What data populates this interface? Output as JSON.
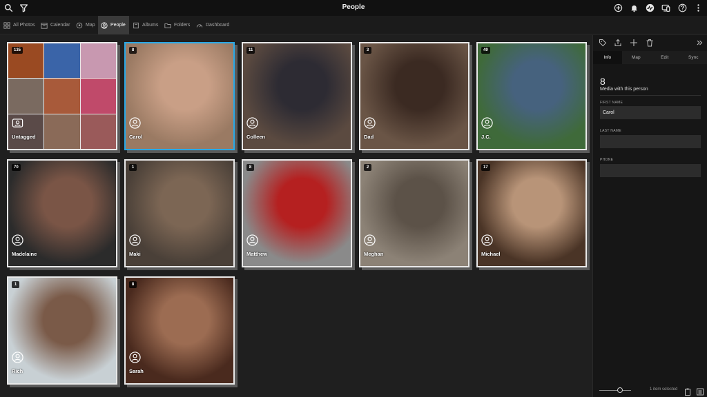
{
  "app": {
    "title": "People"
  },
  "topbar": {
    "left_icons": [
      "search-icon",
      "filter-icon"
    ],
    "right_icons": [
      "add-icon",
      "notifications-icon",
      "activity-icon",
      "devices-icon",
      "help-icon",
      "more-icon"
    ]
  },
  "nav": {
    "items": [
      {
        "label": "All Photos",
        "icon": "grid-icon"
      },
      {
        "label": "Calendar",
        "icon": "calendar-icon"
      },
      {
        "label": "Map",
        "icon": "map-pin-icon"
      },
      {
        "label": "People",
        "icon": "person-icon",
        "active": true
      },
      {
        "label": "Albums",
        "icon": "album-icon"
      },
      {
        "label": "Folders",
        "icon": "folder-icon"
      },
      {
        "label": "Dashboard",
        "icon": "gauge-icon"
      }
    ]
  },
  "people": [
    {
      "name": "Untagged",
      "count": "135",
      "colors": [
        "#6b4a2e",
        "#2e4f8a"
      ]
    },
    {
      "name": "Carol",
      "count": "8",
      "selected": true,
      "colors": [
        "#9a7a63",
        "#c99f86"
      ]
    },
    {
      "name": "Colleen",
      "count": "11",
      "colors": [
        "#5b4a40",
        "#2d2b33"
      ]
    },
    {
      "name": "Dad",
      "count": "3",
      "colors": [
        "#6a5546",
        "#3b2a22"
      ]
    },
    {
      "name": "J.C.",
      "count": "49",
      "colors": [
        "#3f6a3a",
        "#46627e"
      ]
    },
    {
      "name": "Madelaine",
      "count": "70",
      "colors": [
        "#2b2b2b",
        "#7a5546"
      ]
    },
    {
      "name": "Maki",
      "count": "1",
      "colors": [
        "#4a4038",
        "#7c6654"
      ]
    },
    {
      "name": "Matthew",
      "count": "8",
      "colors": [
        "#8a8a8a",
        "#b52020"
      ]
    },
    {
      "name": "Meghan",
      "count": "2",
      "colors": [
        "#8c8276",
        "#5c5248"
      ]
    },
    {
      "name": "Michael",
      "count": "17",
      "colors": [
        "#4a3426",
        "#b89478"
      ]
    },
    {
      "name": "Rich",
      "count": "1",
      "colors": [
        "#c8d0d4",
        "#7a5a48"
      ]
    },
    {
      "name": "Sarah",
      "count": "8",
      "colors": [
        "#4a2a1e",
        "#9c6c52"
      ]
    }
  ],
  "untagged_mosaic_colors": [
    "#9a4a22",
    "#3a64a8",
    "#c898b0",
    "#7a6a60",
    "#a85a3a",
    "#c04a6a",
    "#5a4a48",
    "#8a6a58",
    "#9a5a5a"
  ],
  "panel": {
    "toolbar_icons": [
      "tag-icon",
      "share-icon",
      "add-icon",
      "trash-icon",
      "expand-icon"
    ],
    "tabs": [
      {
        "label": "Info",
        "active": true
      },
      {
        "label": "Map"
      },
      {
        "label": "Edit"
      },
      {
        "label": "Sync"
      }
    ],
    "media_count": "8",
    "media_caption": "Media with this person",
    "fields": [
      {
        "label": "FIRST NAME",
        "value": "Carol"
      },
      {
        "label": "LAST NAME",
        "value": ""
      },
      {
        "label": "PHONE",
        "value": ""
      }
    ],
    "footer": {
      "zoom_level": 0.65,
      "status": "1 item selected",
      "icons": [
        "clipboard-icon",
        "list-icon"
      ]
    }
  },
  "colors": {
    "accent": "#29a9e7",
    "background": "#1f1f1f",
    "topbar": "#111111",
    "panel": "#161616"
  }
}
